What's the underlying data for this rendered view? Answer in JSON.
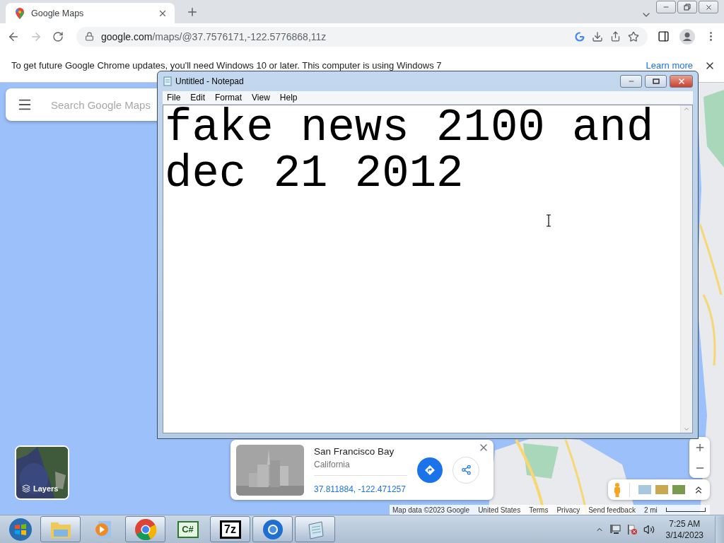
{
  "browser": {
    "tab": {
      "title": "Google Maps"
    },
    "url": {
      "host": "google.com",
      "path": "/maps/@37.7576171,-122.5776868,11z"
    },
    "forward_disabled": true
  },
  "infobar": {
    "message": "To get future Google Chrome updates, you'll need Windows 10 or later. This computer is using Windows 7",
    "link": "Learn more"
  },
  "map": {
    "search": {
      "placeholder": "Search Google Maps"
    },
    "layers": {
      "label": "Layers"
    },
    "place_card": {
      "title": "San Francisco Bay",
      "subtitle": "California",
      "coordinates": "37.811884, -122.471257"
    },
    "attribution": [
      "Map data ©2023 Google",
      "United States",
      "Terms",
      "Privacy",
      "Send feedback"
    ],
    "scale": "2 mi"
  },
  "notepad": {
    "title": "Untitled - Notepad",
    "menu": [
      "File",
      "Edit",
      "Format",
      "View",
      "Help"
    ],
    "content": "fake news 2100 and\ndec 21 2012"
  },
  "taskbar": {
    "items": [
      {
        "kind": "start"
      },
      {
        "kind": "folder",
        "open": true
      },
      {
        "kind": "media",
        "open": false
      },
      {
        "kind": "chrome",
        "open": true
      },
      {
        "kind": "csharp",
        "label": "C#",
        "open": false
      },
      {
        "kind": "archive",
        "label": "7z",
        "open": true
      },
      {
        "kind": "chromium",
        "open": true
      },
      {
        "kind": "notepad",
        "open": true
      }
    ],
    "clock": {
      "time": "7:25 AM",
      "date": "3/14/2023"
    }
  }
}
